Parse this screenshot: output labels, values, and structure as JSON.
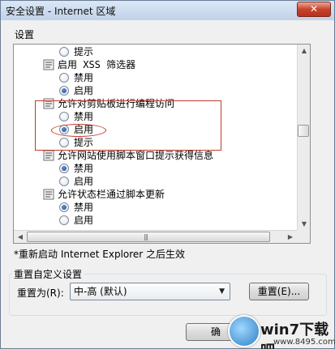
{
  "window": {
    "title": "安全设置 - Internet 区域",
    "close_label": "✕"
  },
  "settings_label": "设置",
  "tree": [
    {
      "kind": "radio",
      "label": "提示",
      "checked": false
    },
    {
      "kind": "category",
      "label": "启用 XSS 筛选器"
    },
    {
      "kind": "radio",
      "label": "禁用",
      "checked": false
    },
    {
      "kind": "radio",
      "label": "启用",
      "checked": true
    },
    {
      "kind": "category",
      "label": "允许对剪贴板进行编程访问"
    },
    {
      "kind": "radio",
      "label": "禁用",
      "checked": false
    },
    {
      "kind": "radio",
      "label": "启用",
      "checked": true
    },
    {
      "kind": "radio",
      "label": "提示",
      "checked": false
    },
    {
      "kind": "category",
      "label": "允许网站使用脚本窗口提示获得信息"
    },
    {
      "kind": "radio",
      "label": "禁用",
      "checked": true
    },
    {
      "kind": "radio",
      "label": "启用",
      "checked": false
    },
    {
      "kind": "category",
      "label": "允许状态栏通过脚本更新"
    },
    {
      "kind": "radio",
      "label": "禁用",
      "checked": true
    },
    {
      "kind": "radio",
      "label": "启用",
      "checked": false
    }
  ],
  "note": "*重新启动 Internet Explorer 之后生效",
  "reset_group": {
    "title": "重置自定义设置",
    "reset_to_label": "重置为(R):",
    "selected": "中-高 (默认)",
    "reset_button": "重置(E)..."
  },
  "footer": {
    "ok_button": "确"
  },
  "watermark": {
    "text": "win7下载吧",
    "sub": "www.8495.com"
  }
}
